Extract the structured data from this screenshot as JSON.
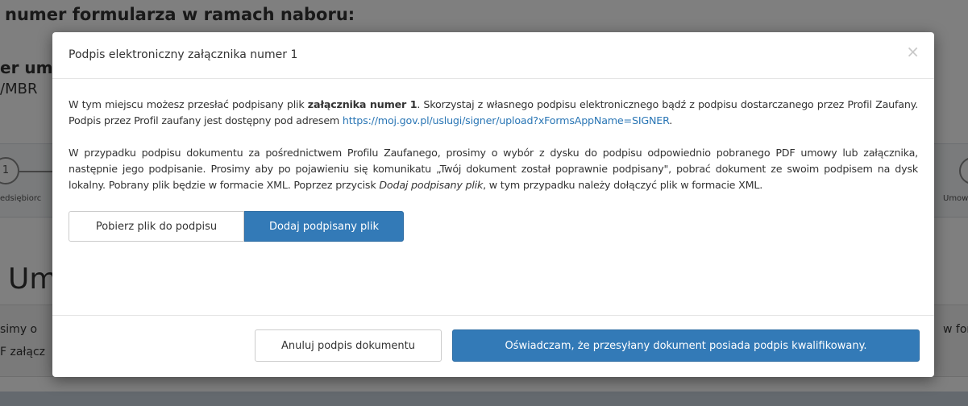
{
  "background": {
    "heading": "numer formularza w ramach naboru:",
    "sub1": "er um",
    "sub2": "/MBR",
    "step_number": "1",
    "step_label_left": "edsiębiorc",
    "step_label_right": "Umow",
    "big_text": "Um",
    "info_line1": "simy o",
    "info_line2": "F załącz",
    "info_right": "w for"
  },
  "modal": {
    "title": "Podpis elektroniczny załącznika numer 1",
    "close_label": "×",
    "p1_pre": "W tym miejscu możesz przesłać podpisany plik ",
    "p1_bold": "załącznika numer 1",
    "p1_post": ". Skorzystaj z własnego podpisu elektronicznego bądź z podpisu dostarczanego przez Profil Zaufany. Podpis przez Profil zaufany jest dostępny pod adresem ",
    "p1_link": "https://moj.gov.pl/uslugi/signer/upload?xFormsAppName=SIGNER",
    "p1_end": ".",
    "p2_pre": "W przypadku podpisu dokumentu za pośrednictwem Profilu Zaufanego, prosimy o wybór z dysku do podpisu odpowiednio pobranego PDF umowy lub załącznika, następnie jego podpisanie. Prosimy aby po pojawieniu się komunikatu „Twój dokument został poprawnie podpisany\", pobrać dokument ze swoim podpisem na dysk lokalny. Pobrany plik będzie w formacie XML. Poprzez przycisk ",
    "p2_italic": "Dodaj podpisany plik",
    "p2_post": ", w tym przypadku należy dołączyć plik w formacie XML.",
    "download_button": "Pobierz plik do podpisu",
    "add_button": "Dodaj podpisany plik",
    "cancel_button": "Anuluj podpis dokumentu",
    "confirm_button": "Oświadczam, że przesyłany dokument posiada podpis kwalifikowany."
  },
  "colors": {
    "primary": "#337ab7",
    "link": "#2a76b5"
  }
}
